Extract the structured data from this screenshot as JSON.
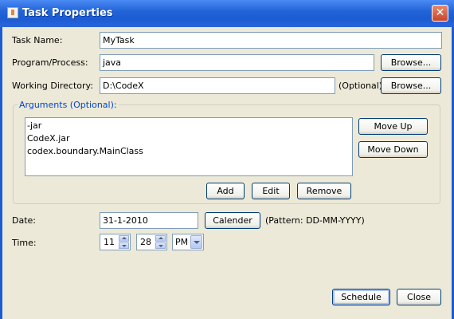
{
  "window": {
    "title": "Task Properties",
    "close_glyph": "✕",
    "icon": "java-cup-icon"
  },
  "labels": {
    "task_name": "Task Name:",
    "program": "Program/Process:",
    "working_dir": "Working Directory:",
    "optional": "(Optional)",
    "arguments_group": "Arguments (Optional):",
    "date": "Date:",
    "time": "Time:",
    "pattern": "(Pattern: DD-MM-YYYY)"
  },
  "fields": {
    "task_name": "MyTask",
    "program": "java",
    "working_dir": "D:\\CodeX",
    "date": "31-1-2010"
  },
  "arguments": [
    "-jar",
    "CodeX.jar",
    "codex.boundary.MainClass"
  ],
  "time": {
    "hour": "11",
    "minute": "28",
    "ampm": "PM"
  },
  "buttons": {
    "browse_program": "Browse...",
    "browse_dir": "Browse...",
    "move_up": "Move Up",
    "move_down": "Move Down",
    "add": "Add",
    "edit": "Edit",
    "remove": "Remove",
    "calender": "Calender",
    "schedule": "Schedule",
    "close": "Close"
  }
}
